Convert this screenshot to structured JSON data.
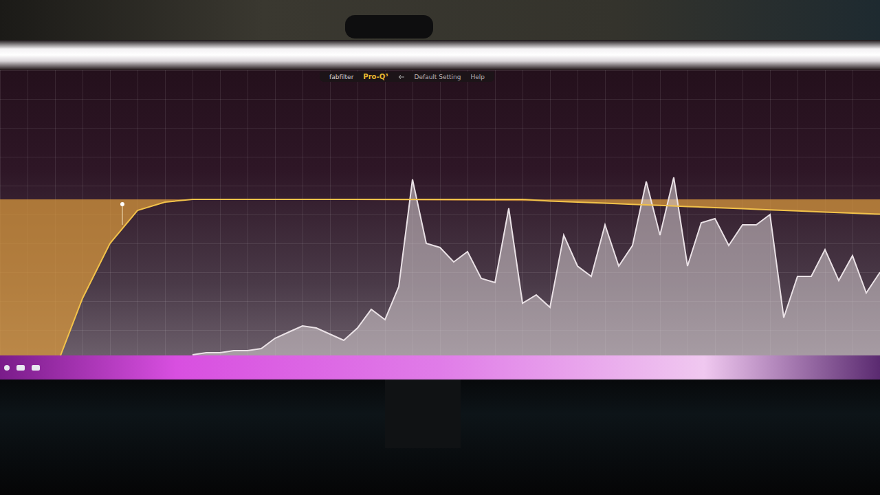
{
  "app": {
    "brand": "fabfilter",
    "product": "Pro-Q³",
    "preset": "Default Setting",
    "help": "Help"
  },
  "eq_curve": {
    "unit": "dB",
    "gains": [
      -40,
      -40,
      -31,
      -18,
      -8,
      -2,
      -0.5,
      0,
      0,
      0,
      0,
      0,
      0,
      0,
      0,
      0,
      0,
      0,
      0,
      0,
      -0.3,
      -0.5,
      -0.7,
      -0.9,
      -1.1,
      -1.3,
      -1.5,
      -1.7,
      -1.9,
      -2.1,
      -2.3,
      -2.5,
      -2.7
    ]
  },
  "spectrum": {
    "unit": "dB",
    "levels": [
      -88,
      -87,
      -87,
      -86,
      -86,
      -85,
      -80,
      -77,
      -74,
      -75,
      -78,
      -81,
      -75,
      -66,
      -71,
      -55,
      -3,
      -34,
      -36,
      -43,
      -38,
      -51,
      -53,
      -17,
      -63,
      -59,
      -65,
      -30,
      -45,
      -50,
      -25,
      -45,
      -35,
      -4,
      -30,
      -2,
      -45,
      -24,
      -22,
      -35,
      -25,
      -25,
      -20,
      -70,
      -50,
      -50,
      -37,
      -52,
      -40,
      -58,
      -48
    ]
  }
}
